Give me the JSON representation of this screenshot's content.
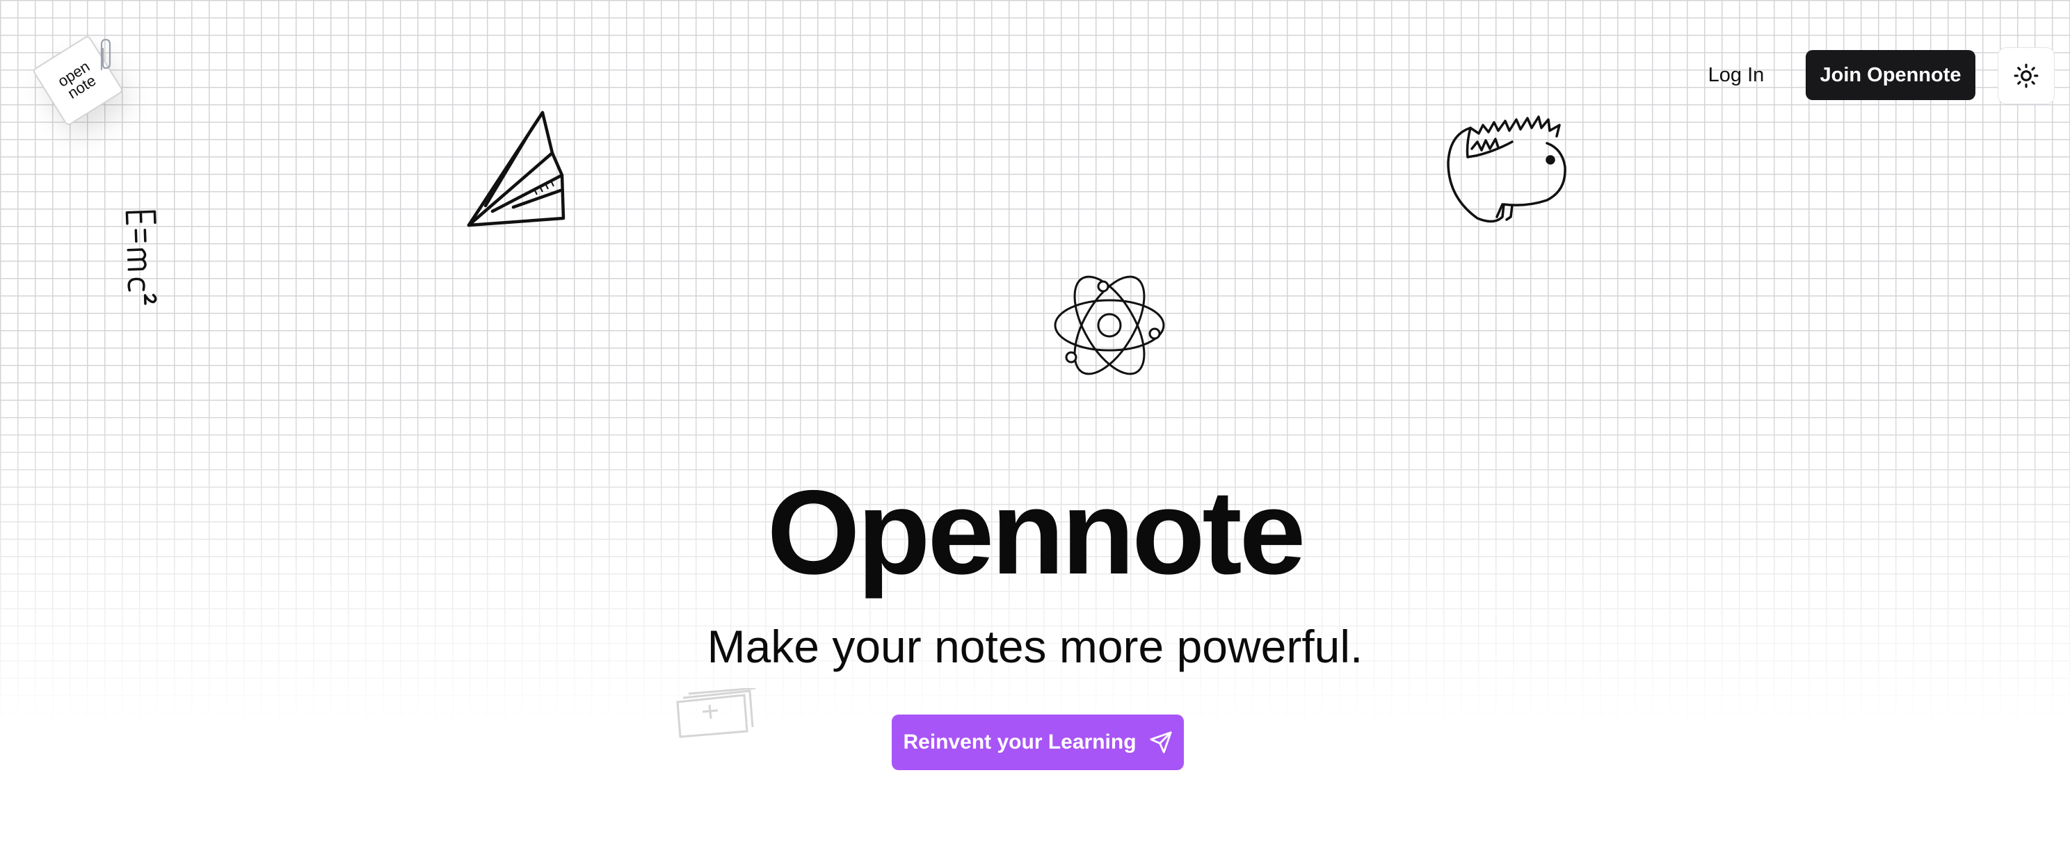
{
  "logo": {
    "line1": "open",
    "line2": "note"
  },
  "nav": {
    "login_label": "Log In",
    "join_label": "Join Opennote",
    "theme_icon": "sun-icon"
  },
  "doodles": {
    "equation_text": "E=mc²",
    "items": [
      "paper-plane-icon",
      "atom-icon",
      "dinosaur-icon",
      "equation-doodle",
      "notebook-doodle"
    ]
  },
  "hero": {
    "title": "Opennote",
    "subtitle": "Make your notes more powerful.",
    "cta_label": "Reinvent your Learning",
    "cta_icon": "send-icon"
  },
  "colors": {
    "accent": "#a855f7",
    "dark_button": "#18181b",
    "grid_line": "#d4d4d8",
    "text": "#0b0b0b"
  }
}
